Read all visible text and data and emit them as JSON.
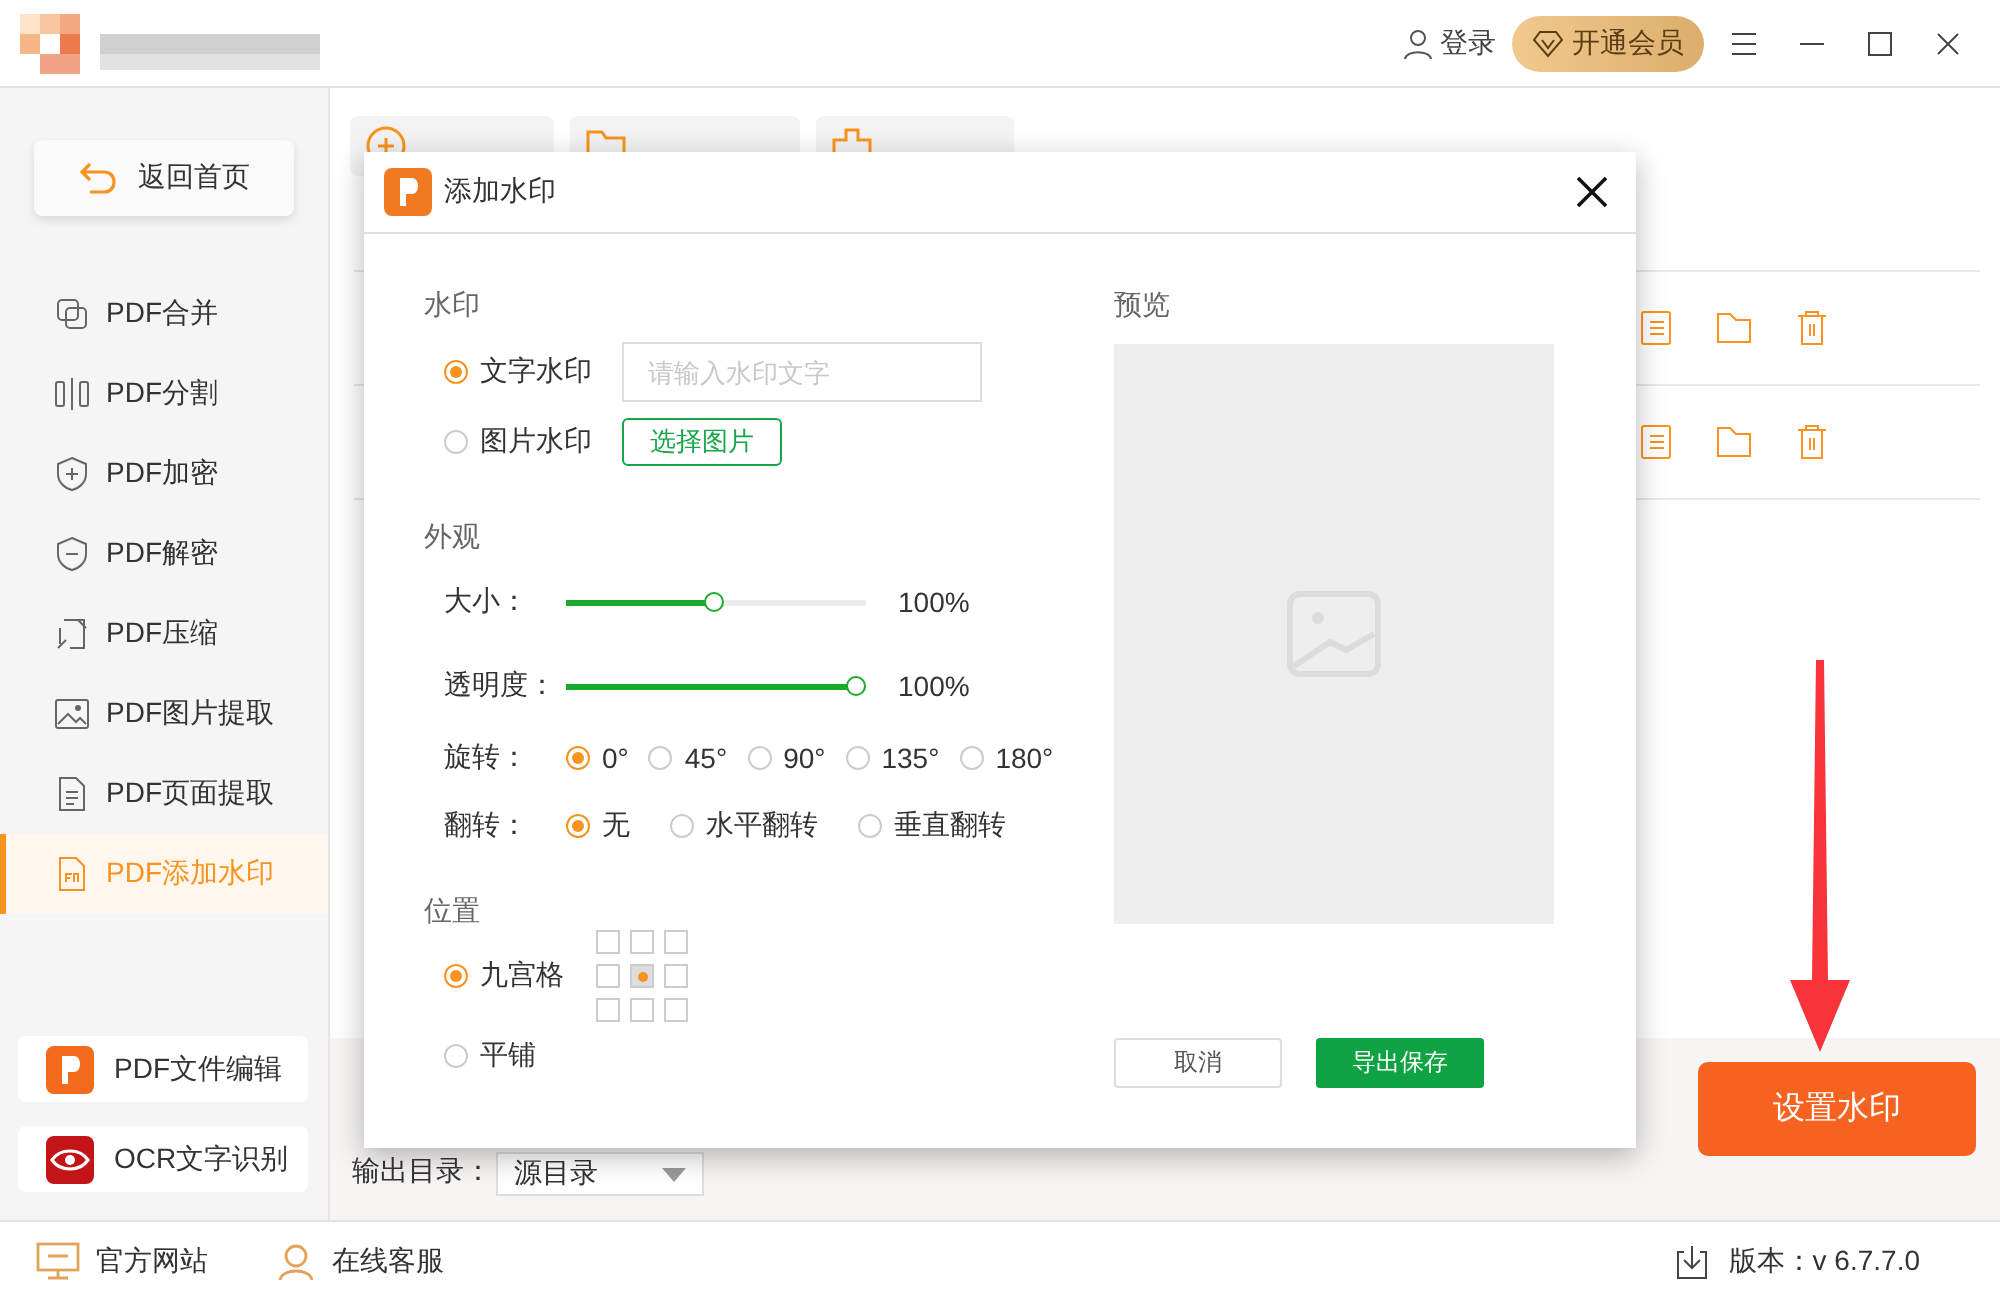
{
  "titlebar": {
    "login": "登录",
    "vip": "开通会员"
  },
  "sidebar": {
    "home_button": "返回首页",
    "items": [
      {
        "label": "PDF合并",
        "kind": "merge",
        "selected": false
      },
      {
        "label": "PDF分割",
        "kind": "split",
        "selected": false
      },
      {
        "label": "PDF加密",
        "kind": "lock",
        "selected": false
      },
      {
        "label": "PDF解密",
        "kind": "unlock",
        "selected": false
      },
      {
        "label": "PDF压缩",
        "kind": "compress",
        "selected": false
      },
      {
        "label": "PDF图片提取",
        "kind": "image",
        "selected": false
      },
      {
        "label": "PDF页面提取",
        "kind": "page",
        "selected": false
      },
      {
        "label": "PDF添加水印",
        "kind": "watermark",
        "selected": true
      }
    ],
    "promos": [
      {
        "label": "PDF文件编辑",
        "kind": "editor"
      },
      {
        "label": "OCR文字识别",
        "kind": "ocr"
      }
    ]
  },
  "toolbar": [
    {
      "kind": "add"
    },
    {
      "kind": "folder"
    },
    {
      "kind": "clear"
    }
  ],
  "file_rows": [
    {
      "kind": "file"
    },
    {
      "kind": "file"
    }
  ],
  "output": {
    "label": "输出目录：",
    "directory": "源目录"
  },
  "start_button": "设置水印",
  "footer": {
    "website": "官方网站",
    "support": "在线客服",
    "version": "版本：v 6.7.7.0"
  },
  "dialog": {
    "title": "添加水印",
    "watermark": {
      "heading": "水印",
      "text_option": {
        "label": "文字水印",
        "selected": true
      },
      "text_placeholder": "请输入水印文字",
      "image_option": {
        "label": "图片水印",
        "selected": false
      },
      "choose_image": "选择图片"
    },
    "appearance": {
      "heading": "外观",
      "sliders": [
        {
          "label": "大小：",
          "level": 0.49,
          "reading": "100%"
        },
        {
          "label": "透明度：",
          "level": 1,
          "reading": "100%"
        }
      ],
      "radio_rows": [
        {
          "label": "旋转：",
          "options": [
            {
              "label": "0°",
              "selected": true
            },
            {
              "label": "45°",
              "selected": false
            },
            {
              "label": "90°",
              "selected": false
            },
            {
              "label": "135°",
              "selected": false
            },
            {
              "label": "180°",
              "selected": false
            }
          ]
        },
        {
          "label": "翻转：",
          "options": [
            {
              "label": "无",
              "selected": true
            },
            {
              "label": "水平翻转",
              "selected": false
            },
            {
              "label": "垂直翻转",
              "selected": false
            }
          ]
        }
      ]
    },
    "position": {
      "heading": "位置",
      "grid_option": {
        "label": "九宫格",
        "selected": true
      },
      "grid_cells": [
        {
          "selected": false
        },
        {
          "selected": false
        },
        {
          "selected": false
        },
        {
          "selected": false
        },
        {
          "selected": true
        },
        {
          "selected": false
        },
        {
          "selected": false
        },
        {
          "selected": false
        },
        {
          "selected": false
        }
      ],
      "tile_option": {
        "label": "平铺",
        "selected": false
      }
    },
    "preview": {
      "heading": "预览"
    },
    "buttons": [
      {
        "label": "取消",
        "kind": "secondary"
      },
      {
        "label": "导出保存",
        "kind": "primary"
      }
    ]
  }
}
